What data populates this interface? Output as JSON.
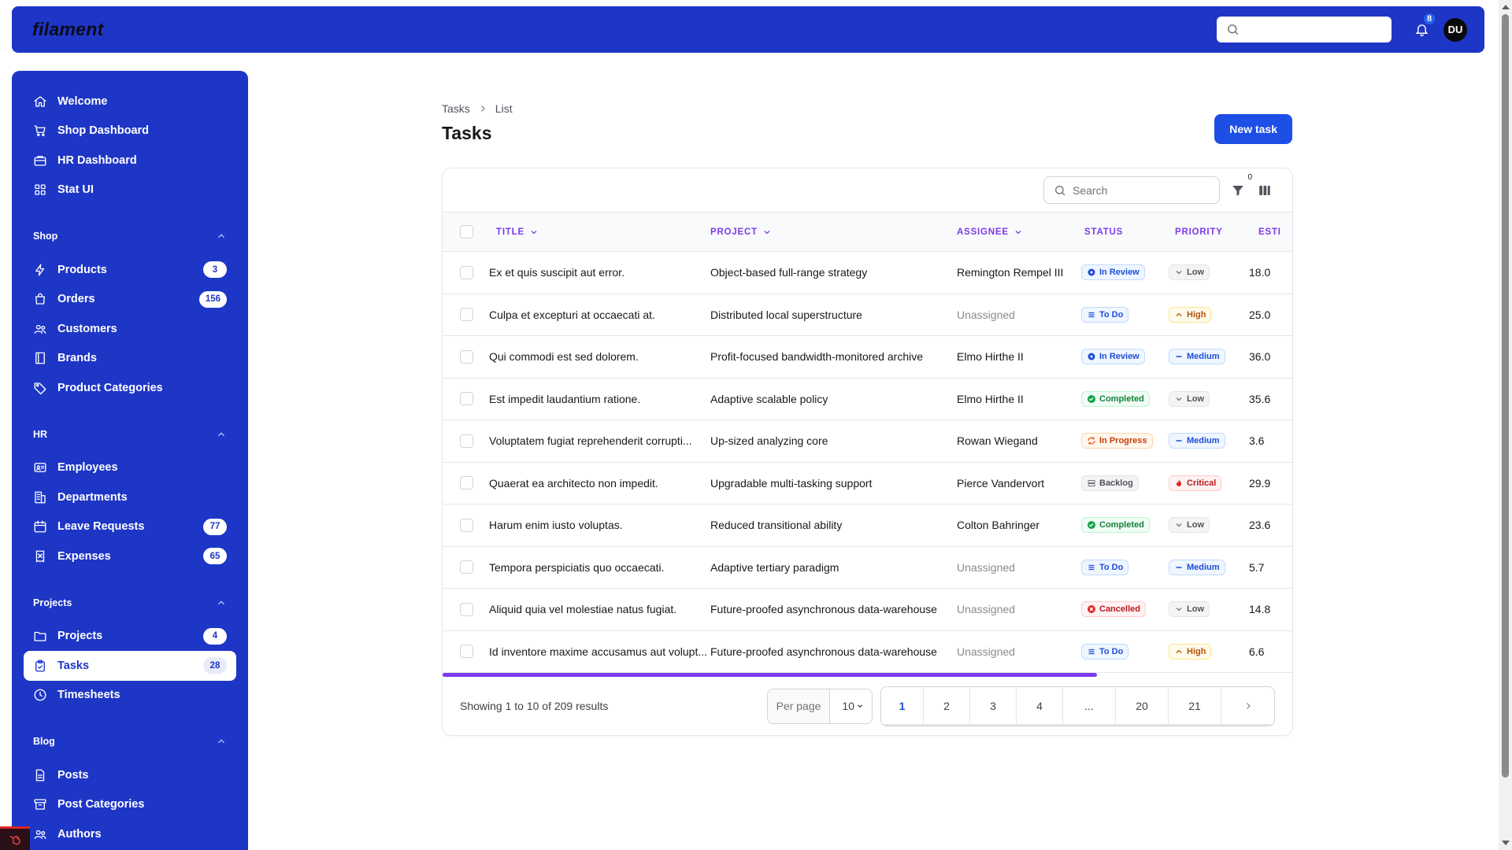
{
  "app": {
    "logo": "filament"
  },
  "topbar": {
    "search_placeholder": "",
    "notifications_count": "8",
    "avatar_initials": "DU"
  },
  "sidebar": {
    "top_items": [
      {
        "label": "Welcome",
        "icon": "home-icon"
      },
      {
        "label": "Shop Dashboard",
        "icon": "cart-icon"
      },
      {
        "label": "HR Dashboard",
        "icon": "briefcase-icon"
      },
      {
        "label": "Stat UI",
        "icon": "grid-icon"
      }
    ],
    "groups": [
      {
        "label": "Shop",
        "items": [
          {
            "label": "Products",
            "icon": "bolt-icon",
            "count": "3"
          },
          {
            "label": "Orders",
            "icon": "bag-icon",
            "count": "156"
          },
          {
            "label": "Customers",
            "icon": "users-icon",
            "count": ""
          },
          {
            "label": "Brands",
            "icon": "book-icon",
            "count": ""
          },
          {
            "label": "Product Categories",
            "icon": "tag-icon",
            "count": ""
          }
        ]
      },
      {
        "label": "HR",
        "items": [
          {
            "label": "Employees",
            "icon": "id-card-icon",
            "count": ""
          },
          {
            "label": "Departments",
            "icon": "building-icon",
            "count": ""
          },
          {
            "label": "Leave Requests",
            "icon": "calendar-icon",
            "count": "77"
          },
          {
            "label": "Expenses",
            "icon": "receipt-icon",
            "count": "65"
          }
        ]
      },
      {
        "label": "Projects",
        "items": [
          {
            "label": "Projects",
            "icon": "folder-icon",
            "count": "4"
          },
          {
            "label": "Tasks",
            "icon": "clipboard-icon",
            "count": "28",
            "active": true
          },
          {
            "label": "Timesheets",
            "icon": "clock-icon",
            "count": ""
          }
        ]
      },
      {
        "label": "Blog",
        "items": [
          {
            "label": "Posts",
            "icon": "document-icon",
            "count": ""
          },
          {
            "label": "Post Categories",
            "icon": "archive-icon",
            "count": ""
          },
          {
            "label": "Authors",
            "icon": "users-icon",
            "count": ""
          }
        ]
      }
    ]
  },
  "breadcrumb": {
    "first": "Tasks",
    "second": "List"
  },
  "page": {
    "title": "Tasks",
    "new_button": "New task"
  },
  "table": {
    "search_placeholder": "Search",
    "filter_count": "0",
    "columns": {
      "title": "TITLE",
      "project": "PROJECT",
      "assignee": "ASSIGNEE",
      "status": "STATUS",
      "priority": "PRIORITY",
      "est": "ESTI"
    },
    "rows": [
      {
        "title": "Ex et quis suscipit aut error.",
        "project": "Object-based full-range strategy",
        "assignee": "Remington Rempel III",
        "status": "In Review",
        "priority": "Low",
        "est": "18.0"
      },
      {
        "title": "Culpa et excepturi at occaecati at.",
        "project": "Distributed local superstructure",
        "assignee": "Unassigned",
        "status": "To Do",
        "priority": "High",
        "est": "25.0"
      },
      {
        "title": "Qui commodi est sed dolorem.",
        "project": "Profit-focused bandwidth-monitored archive",
        "assignee": "Elmo Hirthe II",
        "status": "In Review",
        "priority": "Medium",
        "est": "36.0"
      },
      {
        "title": "Est impedit laudantium ratione.",
        "project": "Adaptive scalable policy",
        "assignee": "Elmo Hirthe II",
        "status": "Completed",
        "priority": "Low",
        "est": "35.6"
      },
      {
        "title": "Voluptatem fugiat reprehenderit corrupti...",
        "project": "Up-sized analyzing core",
        "assignee": "Rowan Wiegand",
        "status": "In Progress",
        "priority": "Medium",
        "est": "3.6"
      },
      {
        "title": "Quaerat ea architecto non impedit.",
        "project": "Upgradable multi-tasking support",
        "assignee": "Pierce Vandervort",
        "status": "Backlog",
        "priority": "Critical",
        "est": "29.9"
      },
      {
        "title": "Harum enim iusto voluptas.",
        "project": "Reduced transitional ability",
        "assignee": "Colton Bahringer",
        "status": "Completed",
        "priority": "Low",
        "est": "23.6"
      },
      {
        "title": "Tempora perspiciatis quo occaecati.",
        "project": "Adaptive tertiary paradigm",
        "assignee": "Unassigned",
        "status": "To Do",
        "priority": "Medium",
        "est": "5.7"
      },
      {
        "title": "Aliquid quia vel molestiae natus fugiat.",
        "project": "Future-proofed asynchronous data-warehouse",
        "assignee": "Unassigned",
        "status": "Cancelled",
        "priority": "Low",
        "est": "14.8"
      },
      {
        "title": "Id inventore maxime accusamus aut volupt...",
        "project": "Future-proofed asynchronous data-warehouse",
        "assignee": "Unassigned",
        "status": "To Do",
        "priority": "High",
        "est": "6.6"
      }
    ],
    "horizontal_scroll_fraction": 0.77,
    "summary": "Showing 1 to 10 of 209 results",
    "per_page_label": "Per page",
    "per_page_value": "10",
    "pages": [
      "1",
      "2",
      "3",
      "4",
      "...",
      "20",
      "21"
    ],
    "current_page": "1"
  },
  "colors": {
    "brand": "#1e36c6",
    "primary": "#1d4ee6",
    "accent": "#7c3aed"
  }
}
